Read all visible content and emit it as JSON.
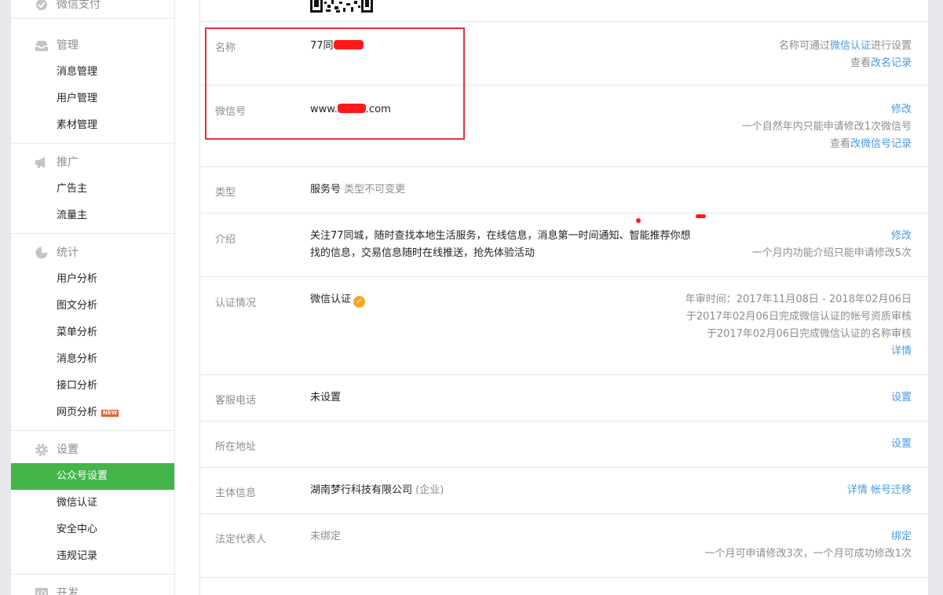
{
  "sidebar": {
    "top_item": "微信支付",
    "groups": [
      {
        "title": "管理",
        "icon": "inbox-icon",
        "items": [
          "消息管理",
          "用户管理",
          "素材管理"
        ]
      },
      {
        "title": "推广",
        "icon": "megaphone-icon",
        "items": [
          "广告主",
          "流量主"
        ]
      },
      {
        "title": "统计",
        "icon": "pie-chart-icon",
        "items": [
          "用户分析",
          "图文分析",
          "菜单分析",
          "消息分析",
          "接口分析",
          "网页分析"
        ]
      },
      {
        "title": "设置",
        "icon": "gear-icon",
        "items": [
          "公众号设置",
          "微信认证",
          "安全中心",
          "违规记录"
        ]
      },
      {
        "title": "开发",
        "icon": "code-icon",
        "items": []
      }
    ],
    "new_badge": "NEW",
    "active_item": "公众号设置"
  },
  "rows": {
    "name": {
      "label": "名称",
      "value_prefix": "77同",
      "hint_prefix": "名称可通过",
      "hint_link": "微信认证",
      "hint_suffix": "进行设置",
      "record_prefix": "查看",
      "record_link": "改名记录"
    },
    "wechat_id": {
      "label": "微信号",
      "value_prefix": "www.",
      "value_suffix": ".com",
      "action": "修改",
      "hint": "一个自然年内只能申请修改1次微信号",
      "record_prefix": "查看",
      "record_link": "改微信号记录"
    },
    "type": {
      "label": "类型",
      "value": "服务号",
      "note": "类型不可变更"
    },
    "intro": {
      "label": "介绍",
      "line1": "关注77同城，随时查找本地生活服务，在线信息，消息第一时间通知、智能推荐你想",
      "line2": "找的信息，交易信息随时在线推送，抢先体验活动",
      "action": "修改",
      "hint": "一个月内功能介绍只能申请修改5次"
    },
    "verify": {
      "label": "认证情况",
      "value": "微信认证",
      "line1": "年审时间：2017年11月08日 - 2018年02月06日",
      "line2": "于2017年02月06日完成微信认证的帐号资质审核",
      "line3": "于2017年02月06日完成微信认证的名称审核",
      "action": "详情"
    },
    "phone": {
      "label": "客服电话",
      "value": "未设置",
      "action": "设置"
    },
    "address": {
      "label": "所在地址",
      "action": "设置"
    },
    "entity": {
      "label": "主体信息",
      "value": "湖南梦行科技有限公司",
      "note": "(企业)",
      "action1": "详情",
      "action2": "帐号迁移"
    },
    "legal": {
      "label": "法定代表人",
      "value": "未绑定",
      "action": "绑定",
      "hint": "一个月可申请修改3次，一个月可成功修改1次"
    }
  }
}
